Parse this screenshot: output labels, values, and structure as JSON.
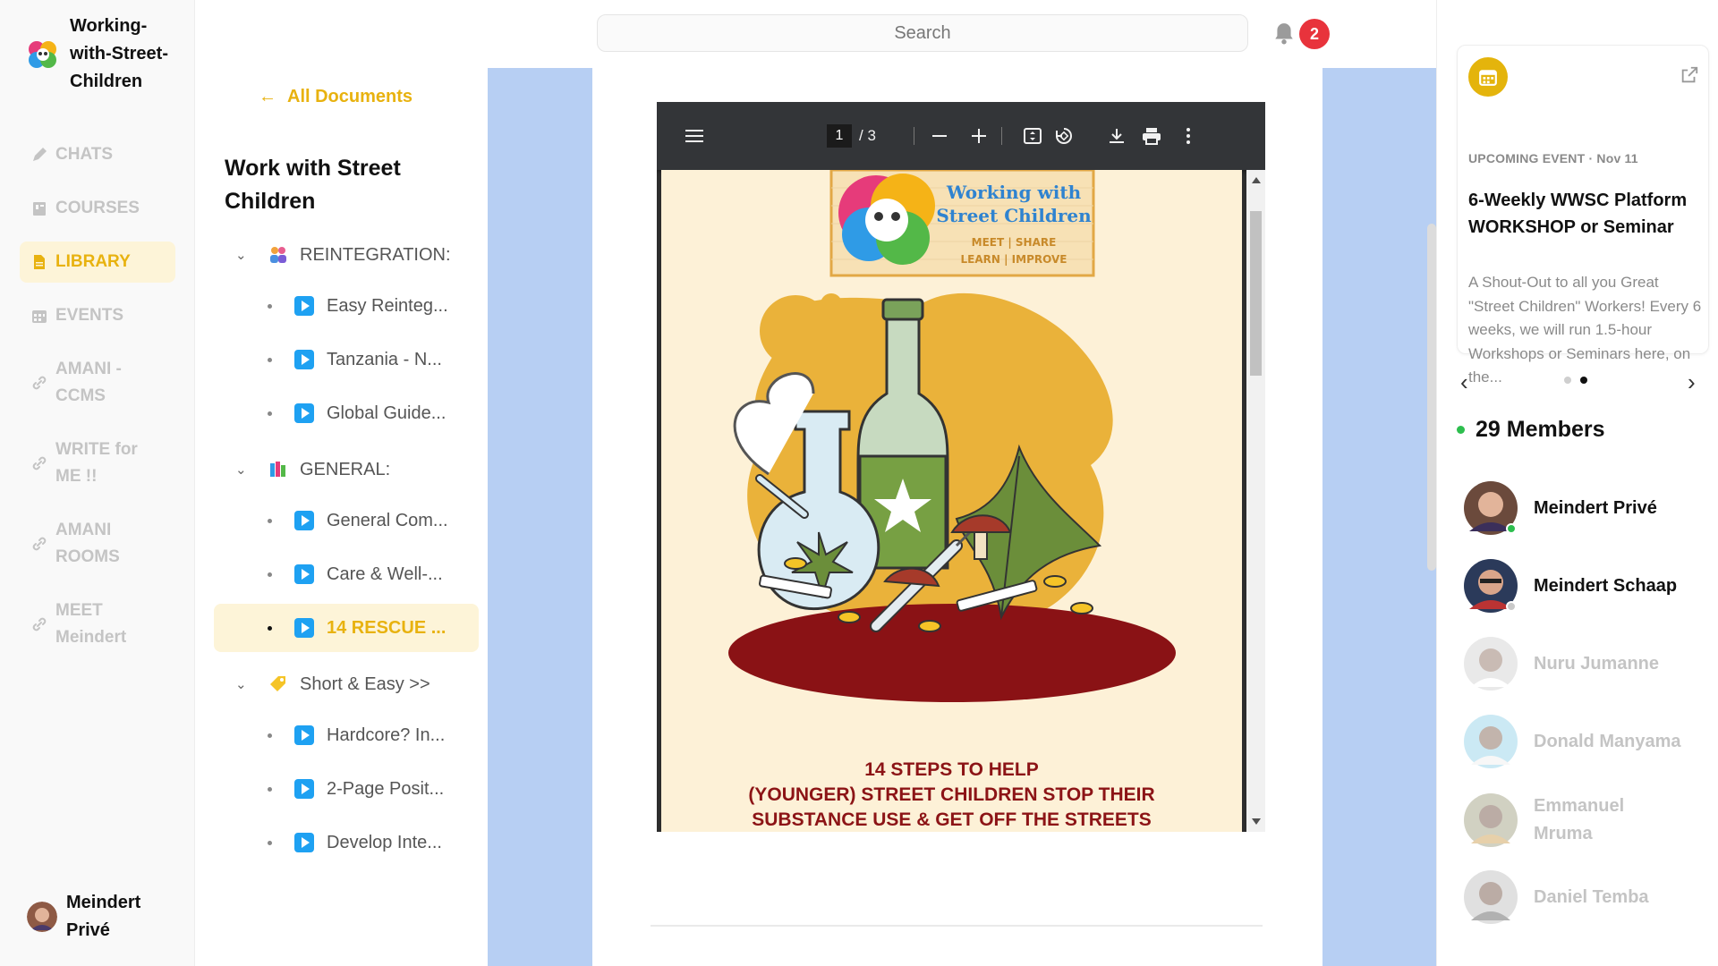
{
  "app": {
    "name": "Working-with-Street-Children"
  },
  "nav": {
    "items": [
      {
        "label": "CHATS",
        "icon": "pen-icon"
      },
      {
        "label": "COURSES",
        "icon": "book-icon"
      },
      {
        "label": "LIBRARY",
        "icon": "document-icon",
        "active": true
      },
      {
        "label": "EVENTS",
        "icon": "calendar-icon"
      },
      {
        "label": "AMANI - CCMS",
        "icon": "link-icon"
      },
      {
        "label": "WRITE for ME !!",
        "icon": "link-icon"
      },
      {
        "label": "AMANI ROOMS",
        "icon": "link-icon"
      },
      {
        "label": "MEET Meindert",
        "icon": "link-icon"
      }
    ],
    "user": "Meindert Privé"
  },
  "tree": {
    "back_label": "All Documents",
    "title": "Work with Street Children",
    "folders": [
      {
        "label": "REINTEGRATION:",
        "docs": [
          "Easy Reinteg...",
          "Tanzania - N...",
          "Global Guide..."
        ]
      },
      {
        "label": "GENERAL:",
        "docs": [
          "General Com...",
          "Care & Well-...",
          "14 RESCUE ..."
        ]
      },
      {
        "label": "Short & Easy >>",
        "docs": [
          "Hardcore? In...",
          "2-Page Posit...",
          "Develop Inte..."
        ]
      }
    ],
    "active_doc": "14 RESCUE ..."
  },
  "header": {
    "search_placeholder": "Search",
    "notifications": "2"
  },
  "pdf": {
    "current_page": "1",
    "total_pages": "/ 3",
    "logo_line1": "Working with",
    "logo_line2": "Street Children",
    "logo_line3": "MEET | SHARE",
    "logo_line4": "LEARN | IMPROVE",
    "title_line1": "14 STEPS TO HELP",
    "title_line2": "(YOUNGER) STREET CHILDREN STOP THEIR",
    "title_line3": "SUBSTANCE USE & GET OFF THE STREETS"
  },
  "event": {
    "meta": "UPCOMING EVENT · Nov 11",
    "title": "6-Weekly WWSC Platform WORKSHOP or Seminar",
    "description": "A Shout-Out to all you Great \"Street Children\" Workers! Every 6 weeks, we will run 1.5-hour Workshops or Seminars here, on the...",
    "slides": 2,
    "active_slide": 1
  },
  "members": {
    "count_label": "29 Members",
    "list": [
      {
        "name": "Meindert Privé",
        "status": "online"
      },
      {
        "name": "Meindert Schaap",
        "status": "away"
      },
      {
        "name": "Nuru Jumanne",
        "status": "offline"
      },
      {
        "name": "Donald Manyama",
        "status": "offline"
      },
      {
        "name": "Emmanuel Mruma",
        "status": "offline"
      },
      {
        "name": "Daniel Temba",
        "status": "offline"
      }
    ]
  },
  "colors": {
    "accent": "#e8b20f",
    "accent_bg": "#fdf4d8",
    "badge": "#e8333c",
    "stage": "#b7cff3",
    "online": "#2dbe4e"
  }
}
